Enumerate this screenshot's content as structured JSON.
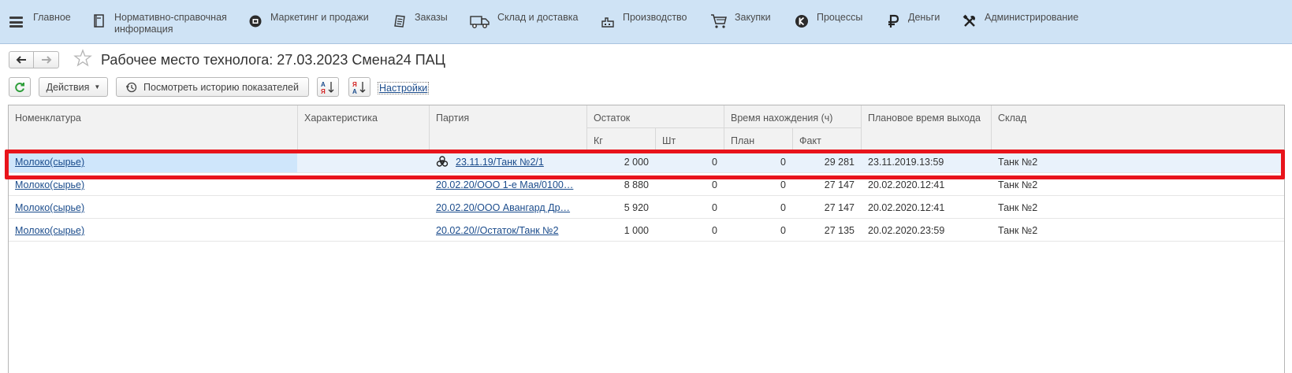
{
  "menu": {
    "items": [
      {
        "label": "Главное",
        "icon": "menu-icon"
      },
      {
        "label": "Нормативно-справочная\nинформация",
        "icon": "book-icon"
      },
      {
        "label": "Маркетинг и продажи",
        "icon": "marketing-icon"
      },
      {
        "label": "Заказы",
        "icon": "orders-icon"
      },
      {
        "label": "Склад и доставка",
        "icon": "truck-icon"
      },
      {
        "label": "Производство",
        "icon": "factory-icon"
      },
      {
        "label": "Закупки",
        "icon": "cart-icon"
      },
      {
        "label": "Процессы",
        "icon": "processes-icon"
      },
      {
        "label": "Деньги",
        "icon": "ruble-icon"
      },
      {
        "label": "Администрирование",
        "icon": "tools-icon"
      }
    ]
  },
  "window": {
    "title": "Рабочее место технолога: 27.03.2023 Смена24 ПАЦ"
  },
  "toolbar": {
    "actions_label": "Действия",
    "history_label": "Посмотреть историю показателей",
    "settings_label": "Настройки"
  },
  "table": {
    "columns": {
      "nomenclature": "Номенклатура",
      "characteristic": "Характеристика",
      "batch": "Партия",
      "balance": "Остаток",
      "balance_kg": "Кг",
      "balance_pcs": "Шт",
      "time_in": "Время нахождения (ч)",
      "time_plan": "План",
      "time_fact": "Факт",
      "planned_exit": "Плановое время выхода",
      "warehouse": "Склад"
    },
    "rows": [
      {
        "nomenclature": "Молоко(сырье)",
        "characteristic": "",
        "batch": "23.11.19/Танк №2/1",
        "kg": "2 000",
        "pcs": "0",
        "plan": "0",
        "fact": "29 281",
        "exit": "23.11.2019.13:59",
        "warehouse": "Танк №2",
        "hazard": true
      },
      {
        "nomenclature": "Молоко(сырье)",
        "characteristic": "",
        "batch": "20.02.20/ООО 1-е Мая/0100…",
        "kg": "8 880",
        "pcs": "0",
        "plan": "0",
        "fact": "27 147",
        "exit": "20.02.2020.12:41",
        "warehouse": "Танк №2",
        "hazard": false
      },
      {
        "nomenclature": "Молоко(сырье)",
        "characteristic": "",
        "batch": "20.02.20/ООО Авангард Др…",
        "kg": "5 920",
        "pcs": "0",
        "plan": "0",
        "fact": "27 147",
        "exit": "20.02.2020.12:41",
        "warehouse": "Танк №2",
        "hazard": false
      },
      {
        "nomenclature": "Молоко(сырье)",
        "characteristic": "",
        "batch": "20.02.20//Остаток/Танк №2",
        "kg": "1 000",
        "pcs": "0",
        "plan": "0",
        "fact": "27 135",
        "exit": "20.02.2020.23:59",
        "warehouse": "Танк №2",
        "hazard": false
      }
    ]
  },
  "colors": {
    "menu_bg": "#cfe3f5",
    "link": "#1b4c8c",
    "highlight": "#e8141b",
    "refresh_green": "#2e9e3a"
  }
}
